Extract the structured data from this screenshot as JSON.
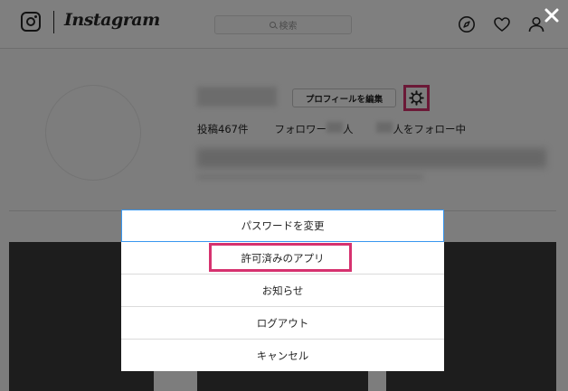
{
  "header": {
    "wordmark": "Instagram",
    "search_placeholder": "検索",
    "icons": [
      "explore-compass-icon",
      "heart-icon",
      "profile-person-icon"
    ]
  },
  "profile": {
    "edit_profile_label": "プロフィールを編集",
    "stats": {
      "posts": "投稿467件",
      "followers_prefix": "フォロワー",
      "followers_suffix": "人",
      "following_suffix": "人をフォロー中"
    }
  },
  "menu": {
    "items": [
      {
        "label": "パスワードを変更"
      },
      {
        "label": "許可済みのアプリ"
      },
      {
        "label": "お知らせ"
      },
      {
        "label": "ログアウト"
      },
      {
        "label": "キャンセル"
      }
    ]
  },
  "colors": {
    "highlight": "#d6326f",
    "focus_border": "#3897f0",
    "overlay": "rgba(0,0,0,0.5)"
  }
}
